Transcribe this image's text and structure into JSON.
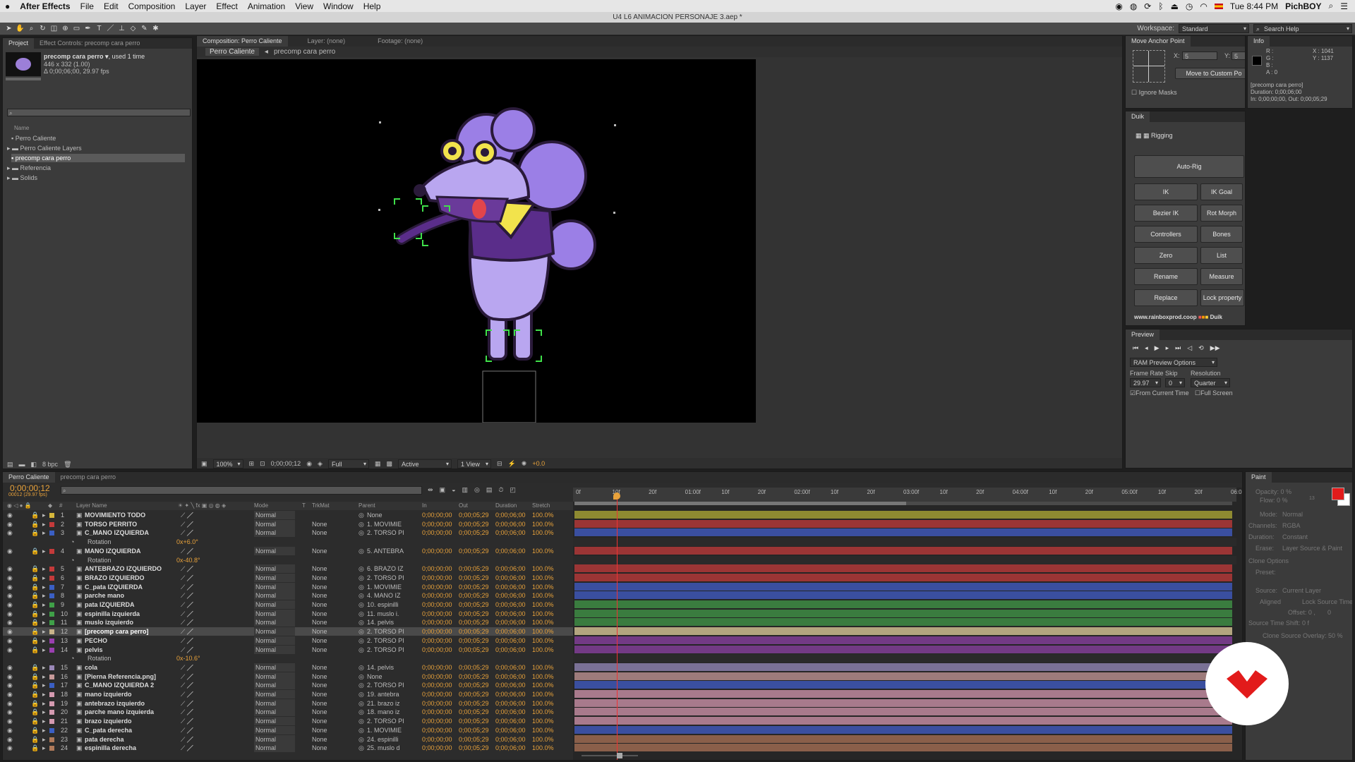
{
  "menubar": {
    "apple": "",
    "app": "After Effects",
    "items": [
      "File",
      "Edit",
      "Composition",
      "Layer",
      "Effect",
      "Animation",
      "View",
      "Window",
      "Help"
    ],
    "clock": "Tue 8:44 PM",
    "user": "PichBOY"
  },
  "titlebar": "U4 L6 ANIMACION PERSONAJE 3.aep *",
  "workspace": {
    "label": "Workspace:",
    "value": "Standard",
    "search": "Search Help"
  },
  "project": {
    "tab": "Project",
    "tab2": "Effect Controls: precomp cara perro",
    "item_name": "precomp cara perro ▾",
    "item_used": ", used 1 time",
    "item_size": "446 x 332 (1.00)",
    "item_duration": "Δ 0;00;06;00, 29.97 fps",
    "col_name": "Name",
    "items": [
      "Perro Caliente",
      "Perro Caliente Layers",
      "precomp cara perro",
      "Referencia",
      "Solids"
    ],
    "bpc": "8 bpc"
  },
  "comp": {
    "tab": "Composition: Perro Caliente",
    "tab_layer": "Layer: (none)",
    "tab_footage": "Footage: (none)",
    "crumb1": "Perro Caliente",
    "crumb2": "precomp cara perro",
    "zoom": "100%",
    "timecode": "0;00;00;12",
    "quality": "Full",
    "camera": "Active Camera",
    "view": "1 View",
    "exposure": "+0.0"
  },
  "anchor": {
    "tab": "Move Anchor Point",
    "x_label": "X:",
    "x_val": "5",
    "y_label": "Y:",
    "y_val": "5",
    "move_btn": "Move to Custom Po",
    "ignore": "Ignore Masks"
  },
  "info": {
    "tab": "Info",
    "r": "R :",
    "g": "G :",
    "b": "B :",
    "a": "A : 0",
    "x": "X : 1041",
    "y": "Y : 1137",
    "line1": "[precomp cara perro]",
    "line2": "Duration: 0;00;06;00",
    "line3": "In: 0;00;00;00, Out: 0;00;05;29"
  },
  "duik": {
    "tab": "Duik",
    "rigging": "Rigging",
    "autorig": "Auto-Rig",
    "buttons": [
      "IK",
      "IK Goal",
      "Bezier IK",
      "Rot Morph",
      "Controllers",
      "Bones",
      "Zero",
      "List",
      "Rename",
      "Measure",
      "Replace",
      "Lock property"
    ],
    "site": "www.rainboxprod.coop",
    "brand": "Duik"
  },
  "preview": {
    "tab": "Preview",
    "options": "RAM Preview Options",
    "fr_label": "Frame Rate",
    "skip_label": "Skip",
    "res_label": "Resolution",
    "fr": "29.97",
    "skip": "0",
    "res": "Quarter",
    "from_current": "From Current Time",
    "full_screen": "Full Screen"
  },
  "paint": {
    "tab": "Paint",
    "opacity": "Opacity: 0 %",
    "flow": "Flow: 0 %",
    "mode_l": "Mode:",
    "mode": "Normal",
    "channels_l": "Channels:",
    "channels": "RGBA",
    "duration_l": "Duration:",
    "duration": "Constant",
    "erase_l": "Erase:",
    "erase": "Layer Source & Paint",
    "clone_opts": "Clone Options",
    "preset": "Preset:",
    "source_l": "Source:",
    "source": "Current Layer",
    "aligned": "Aligned",
    "lock_src": "Lock Source Time",
    "offset": "Offset: 0 ,",
    "offset2": "0",
    "shift": "Source Time Shift: 0 f",
    "overlay": "Clone Source Overlay: 50 %",
    "brush": "13"
  },
  "timeline": {
    "tab": "Perro Caliente",
    "tab2": "precomp cara perro",
    "timecode": "0;00;00;12",
    "fps": "00012 (29.97 fps)",
    "cols": {
      "num": "#",
      "name": "Layer Name",
      "mode": "Mode",
      "t": "T",
      "trkmat": "TrkMat",
      "parent": "Parent",
      "in": "In",
      "out": "Out",
      "duration": "Duration",
      "stretch": "Stretch"
    },
    "ruler": [
      "0f",
      "10f",
      "20f",
      "01:00f",
      "10f",
      "20f",
      "02:00f",
      "10f",
      "20f",
      "03:00f",
      "10f",
      "20f",
      "04:00f",
      "10f",
      "20f",
      "05:00f",
      "10f",
      "20f",
      "06:0"
    ],
    "layers": [
      {
        "n": "1",
        "name": "MOVIMIENTO TODO",
        "mode": "Normal",
        "trk": "",
        "parent": "None",
        "in": "0;00;00;00",
        "out": "0;00;05;29",
        "dur": "0;00;06;00",
        "str": "100.0%",
        "color": "#d4b63b",
        "bar": "#8e8a31"
      },
      {
        "n": "2",
        "name": "TORSO PERRITO",
        "mode": "Normal",
        "trk": "None",
        "parent": "1. MOVIMIE",
        "in": "0;00;00;00",
        "out": "0;00;05;29",
        "dur": "0;00;06;00",
        "str": "100.0%",
        "color": "#c43a3a",
        "bar": "#9b3535"
      },
      {
        "n": "3",
        "name": "C_MANO IZQUIERDA",
        "mode": "Normal",
        "trk": "None",
        "parent": "2. TORSO PI",
        "in": "0;00;00;00",
        "out": "0;00;05;29",
        "dur": "0;00;06;00",
        "str": "100.0%",
        "color": "#3a5fc4",
        "bar": "#3a4fa0"
      },
      {
        "prop": "Rotation",
        "val": "0x+6.0°"
      },
      {
        "n": "4",
        "name": "MANO IZQUIERDA",
        "mode": "Normal",
        "trk": "None",
        "parent": "5. ANTEBRA",
        "in": "0;00;00;00",
        "out": "0;00;05;29",
        "dur": "0;00;06;00",
        "str": "100.0%",
        "color": "#c43a3a",
        "bar": "#9b3535"
      },
      {
        "prop": "Rotation",
        "val": "0x-40.8°"
      },
      {
        "n": "5",
        "name": "ANTEBRAZO IZQUIERDO",
        "mode": "Normal",
        "trk": "None",
        "parent": "6. BRAZO IZ",
        "in": "0;00;00;00",
        "out": "0;00;05;29",
        "dur": "0;00;06;00",
        "str": "100.0%",
        "color": "#c43a3a",
        "bar": "#9b3535"
      },
      {
        "n": "6",
        "name": "BRAZO IZQUIERDO",
        "mode": "Normal",
        "trk": "None",
        "parent": "2. TORSO PI",
        "in": "0;00;00;00",
        "out": "0;00;05;29",
        "dur": "0;00;06;00",
        "str": "100.0%",
        "color": "#c43a3a",
        "bar": "#9b3535"
      },
      {
        "n": "7",
        "name": "C_pata IZQUIERDA",
        "mode": "Normal",
        "trk": "None",
        "parent": "1. MOVIMIE",
        "in": "0;00;00;00",
        "out": "0;00;05;29",
        "dur": "0;00;06;00",
        "str": "100.0%",
        "color": "#3a5fc4",
        "bar": "#3a4fa0"
      },
      {
        "n": "8",
        "name": "parche mano",
        "mode": "Normal",
        "trk": "None",
        "parent": "4. MANO IZ",
        "in": "0;00;00;00",
        "out": "0;00;05;29",
        "dur": "0;00;06;00",
        "str": "100.0%",
        "color": "#3a5fc4",
        "bar": "#3a4fa0"
      },
      {
        "n": "9",
        "name": "pata IZQUIERDA",
        "mode": "Normal",
        "trk": "None",
        "parent": "10. espinilli",
        "in": "0;00;00;00",
        "out": "0;00;05;29",
        "dur": "0;00;06;00",
        "str": "100.0%",
        "color": "#3fa048",
        "bar": "#3a7c3f"
      },
      {
        "n": "10",
        "name": "espinilla izquierda",
        "mode": "Normal",
        "trk": "None",
        "parent": "11. muslo i.",
        "in": "0;00;00;00",
        "out": "0;00;05;29",
        "dur": "0;00;06;00",
        "str": "100.0%",
        "color": "#3fa048",
        "bar": "#3a7c3f"
      },
      {
        "n": "11",
        "name": "muslo izquierdo",
        "mode": "Normal",
        "trk": "None",
        "parent": "14. pelvis",
        "in": "0;00;00;00",
        "out": "0;00;05;29",
        "dur": "0;00;06;00",
        "str": "100.0%",
        "color": "#3fa048",
        "bar": "#3a7c3f"
      },
      {
        "n": "12",
        "name": "[precomp cara perro]",
        "mode": "Normal",
        "trk": "None",
        "parent": "2. TORSO PI",
        "in": "0;00;00;00",
        "out": "0;00;05;29",
        "dur": "0;00;06;00",
        "str": "100.0%",
        "color": "#c9b48a",
        "bar": "#b3a57f",
        "sel": true
      },
      {
        "n": "13",
        "name": "PECHO",
        "mode": "Normal",
        "trk": "None",
        "parent": "2. TORSO PI",
        "in": "0;00;00;00",
        "out": "0;00;05;29",
        "dur": "0;00;06;00",
        "str": "100.0%",
        "color": "#9a3fb0",
        "bar": "#733a85"
      },
      {
        "n": "14",
        "name": "pelvis",
        "mode": "Normal",
        "trk": "None",
        "parent": "2. TORSO PI",
        "in": "0;00;00;00",
        "out": "0;00;05;29",
        "dur": "0;00;06;00",
        "str": "100.0%",
        "color": "#9a3fb0",
        "bar": "#733a85"
      },
      {
        "prop": "Rotation",
        "val": "0x-10.6°"
      },
      {
        "n": "15",
        "name": "cola",
        "mode": "Normal",
        "trk": "None",
        "parent": "14. pelvis",
        "in": "0;00;00;00",
        "out": "0;00;05;29",
        "dur": "0;00;06;00",
        "str": "100.0%",
        "color": "#9a88b8",
        "bar": "#7a7196"
      },
      {
        "n": "16",
        "name": "[Pierna Referencia.png]",
        "mode": "Normal",
        "trk": "None",
        "parent": "None",
        "in": "0;00;00;00",
        "out": "0;00;05;29",
        "dur": "0;00;06;00",
        "str": "100.0%",
        "color": "#c79a9a",
        "bar": "#9d7b7b"
      },
      {
        "n": "17",
        "name": "C_MANO IZQUIERDA 2",
        "mode": "Normal",
        "trk": "None",
        "parent": "2. TORSO PI",
        "in": "0;00;00;00",
        "out": "0;00;05;29",
        "dur": "0;00;06;00",
        "str": "100.0%",
        "color": "#3a5fc4",
        "bar": "#3a4fa0"
      },
      {
        "n": "18",
        "name": "mano izquierdo",
        "mode": "Normal",
        "trk": "None",
        "parent": "19. antebra",
        "in": "0;00;00;00",
        "out": "0;00;05;29",
        "dur": "0;00;06;00",
        "str": "100.0%",
        "color": "#d49ab0",
        "bar": "#a87a8c"
      },
      {
        "n": "19",
        "name": "antebrazo izquierdo",
        "mode": "Normal",
        "trk": "None",
        "parent": "21. brazo iz",
        "in": "0;00;00;00",
        "out": "0;00;05;29",
        "dur": "0;00;06;00",
        "str": "100.0%",
        "color": "#d49ab0",
        "bar": "#a87a8c"
      },
      {
        "n": "20",
        "name": "parche mano izquierda",
        "mode": "Normal",
        "trk": "None",
        "parent": "18. mano iz",
        "in": "0;00;00;00",
        "out": "0;00;05;29",
        "dur": "0;00;06;00",
        "str": "100.0%",
        "color": "#d49ab0",
        "bar": "#a87a8c"
      },
      {
        "n": "21",
        "name": "brazo izquierdo",
        "mode": "Normal",
        "trk": "None",
        "parent": "2. TORSO PI",
        "in": "0;00;00;00",
        "out": "0;00;05;29",
        "dur": "0;00;06;00",
        "str": "100.0%",
        "color": "#d49ab0",
        "bar": "#a87a8c"
      },
      {
        "n": "22",
        "name": "C_pata derecha",
        "mode": "Normal",
        "trk": "None",
        "parent": "1. MOVIMIE",
        "in": "0;00;00;00",
        "out": "0;00;05;29",
        "dur": "0;00;06;00",
        "str": "100.0%",
        "color": "#3a5fc4",
        "bar": "#3a4fa0"
      },
      {
        "n": "23",
        "name": "pata derecha",
        "mode": "Normal",
        "trk": "None",
        "parent": "24. espinilli",
        "in": "0;00;00;00",
        "out": "0;00;05;29",
        "dur": "0;00;06;00",
        "str": "100.0%",
        "color": "#b07a5a",
        "bar": "#8a5f4a"
      },
      {
        "n": "24",
        "name": "espinilla derecha",
        "mode": "Normal",
        "trk": "None",
        "parent": "25. muslo d",
        "in": "0;00;00;00",
        "out": "0;00;05;29",
        "dur": "0;00;06;00",
        "str": "100.0%",
        "color": "#b07a5a",
        "bar": "#8a5f4a"
      }
    ]
  }
}
